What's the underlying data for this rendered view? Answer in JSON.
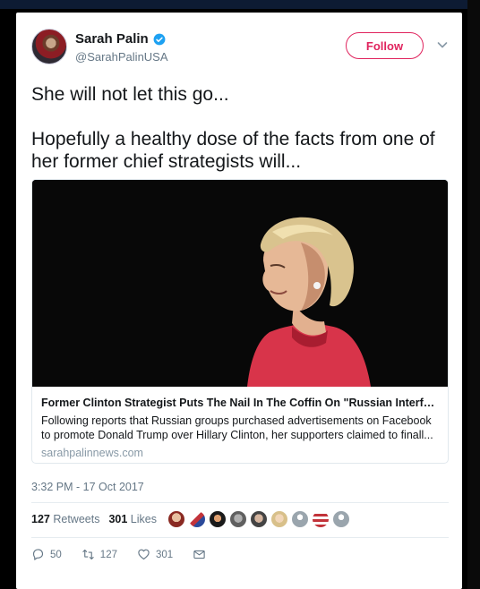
{
  "user": {
    "name": "Sarah Palin",
    "handle": "@SarahPalinUSA",
    "follow_label": "Follow"
  },
  "tweet": {
    "text": "She will not let this go...\n\nHopefully a healthy dose of the facts from one of her former chief strategists will...",
    "timestamp": "3:32 PM - 17 Oct 2017"
  },
  "card": {
    "title": "Former Clinton Strategist Puts The Nail In The Coffin On \"Russian Interferen...",
    "description": "Following reports that Russian groups purchased advertisements on Facebook to promote Donald Trump over Hillary Clinton, her supporters claimed to finall...",
    "domain": "sarahpalinnews.com"
  },
  "stats": {
    "retweets_count": "127",
    "retweets_label": "Retweets",
    "likes_count": "301",
    "likes_label": "Likes"
  },
  "actions": {
    "reply_count": "50",
    "retweet_count": "127",
    "like_count": "301"
  },
  "colors": {
    "follow_accent": "#e0245e",
    "verified_blue": "#1da1f2",
    "muted_text": "#657786"
  }
}
